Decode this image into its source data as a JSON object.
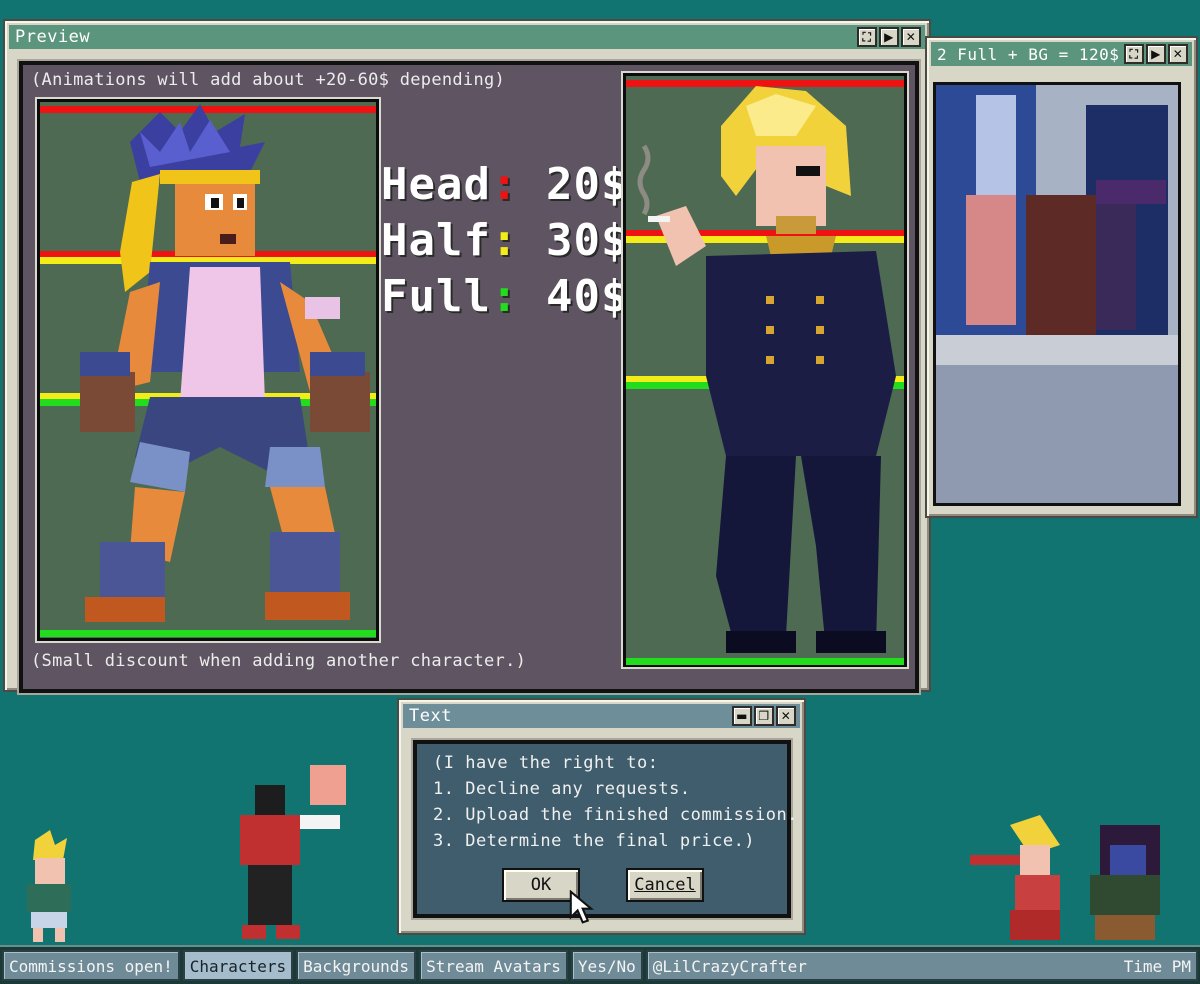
{
  "preview_window": {
    "title": "Preview",
    "note_top": "(Animations will add about +20-60$ depending)",
    "note_bottom": "(Small discount when adding another character.)",
    "prices": [
      {
        "label": "Head",
        "sep": ":",
        "price": "20$",
        "color": "#ee1212"
      },
      {
        "label": "Half",
        "sep": ":",
        "price": "30$",
        "color": "#f4ec18"
      },
      {
        "label": "Full",
        "sep": ":",
        "price": "40$",
        "color": "#22dc1e"
      }
    ]
  },
  "bg_window": {
    "title": "2 Full + BG = 120$"
  },
  "text_window": {
    "title": "Text",
    "lines": [
      "(I have the right to:",
      "1. Decline any requests.",
      "2. Upload the finished commission.",
      "3. Determine the final price.)"
    ],
    "ok_label": "OK",
    "cancel_label": "Cancel"
  },
  "taskbar": {
    "items": [
      "Commissions open!",
      "Characters",
      "Backgrounds",
      "Stream Avatars",
      "Yes/No",
      "@LilCrazyCrafter"
    ],
    "active": "Characters",
    "clock": "Time PM"
  },
  "colors": {
    "desktop": "#127470",
    "titlebar_green": "#5b957e",
    "titlebar_blue": "#6e8e9a",
    "bar_red": "#ee1212",
    "bar_yellow": "#f4ec18",
    "bar_green": "#22dc1e"
  }
}
